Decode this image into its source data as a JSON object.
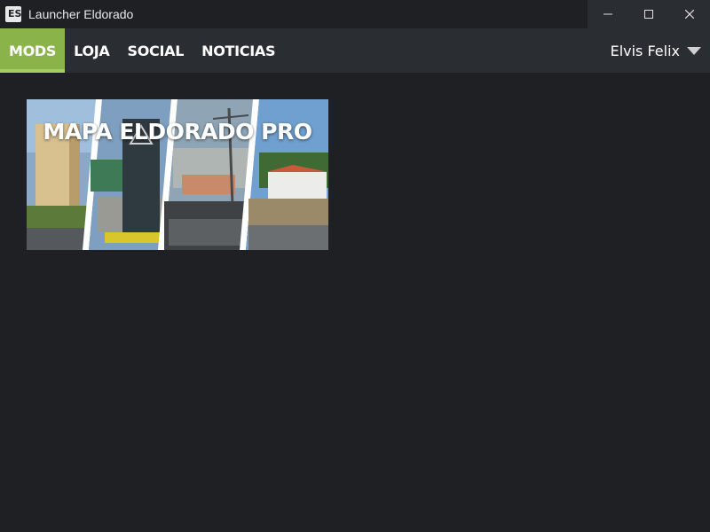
{
  "window": {
    "title": "Launcher Eldorado",
    "icon": "launcher-logo-icon",
    "controls": [
      "minimize-icon",
      "maximize-icon",
      "close-icon"
    ]
  },
  "nav": {
    "tabs": [
      {
        "label": "MODS",
        "active": true
      },
      {
        "label": "LOJA",
        "active": false
      },
      {
        "label": "SOCIAL",
        "active": false
      },
      {
        "label": "NOTICIAS",
        "active": false
      }
    ],
    "user": {
      "name": "Elvis Felix",
      "icon": "chevron-down-icon"
    }
  },
  "mods": [
    {
      "title": "MAPA ELDORADO PRO"
    }
  ],
  "colors": {
    "background": "#1e2024",
    "navbar": "#2a2d31",
    "accent": "#8ab34a"
  }
}
